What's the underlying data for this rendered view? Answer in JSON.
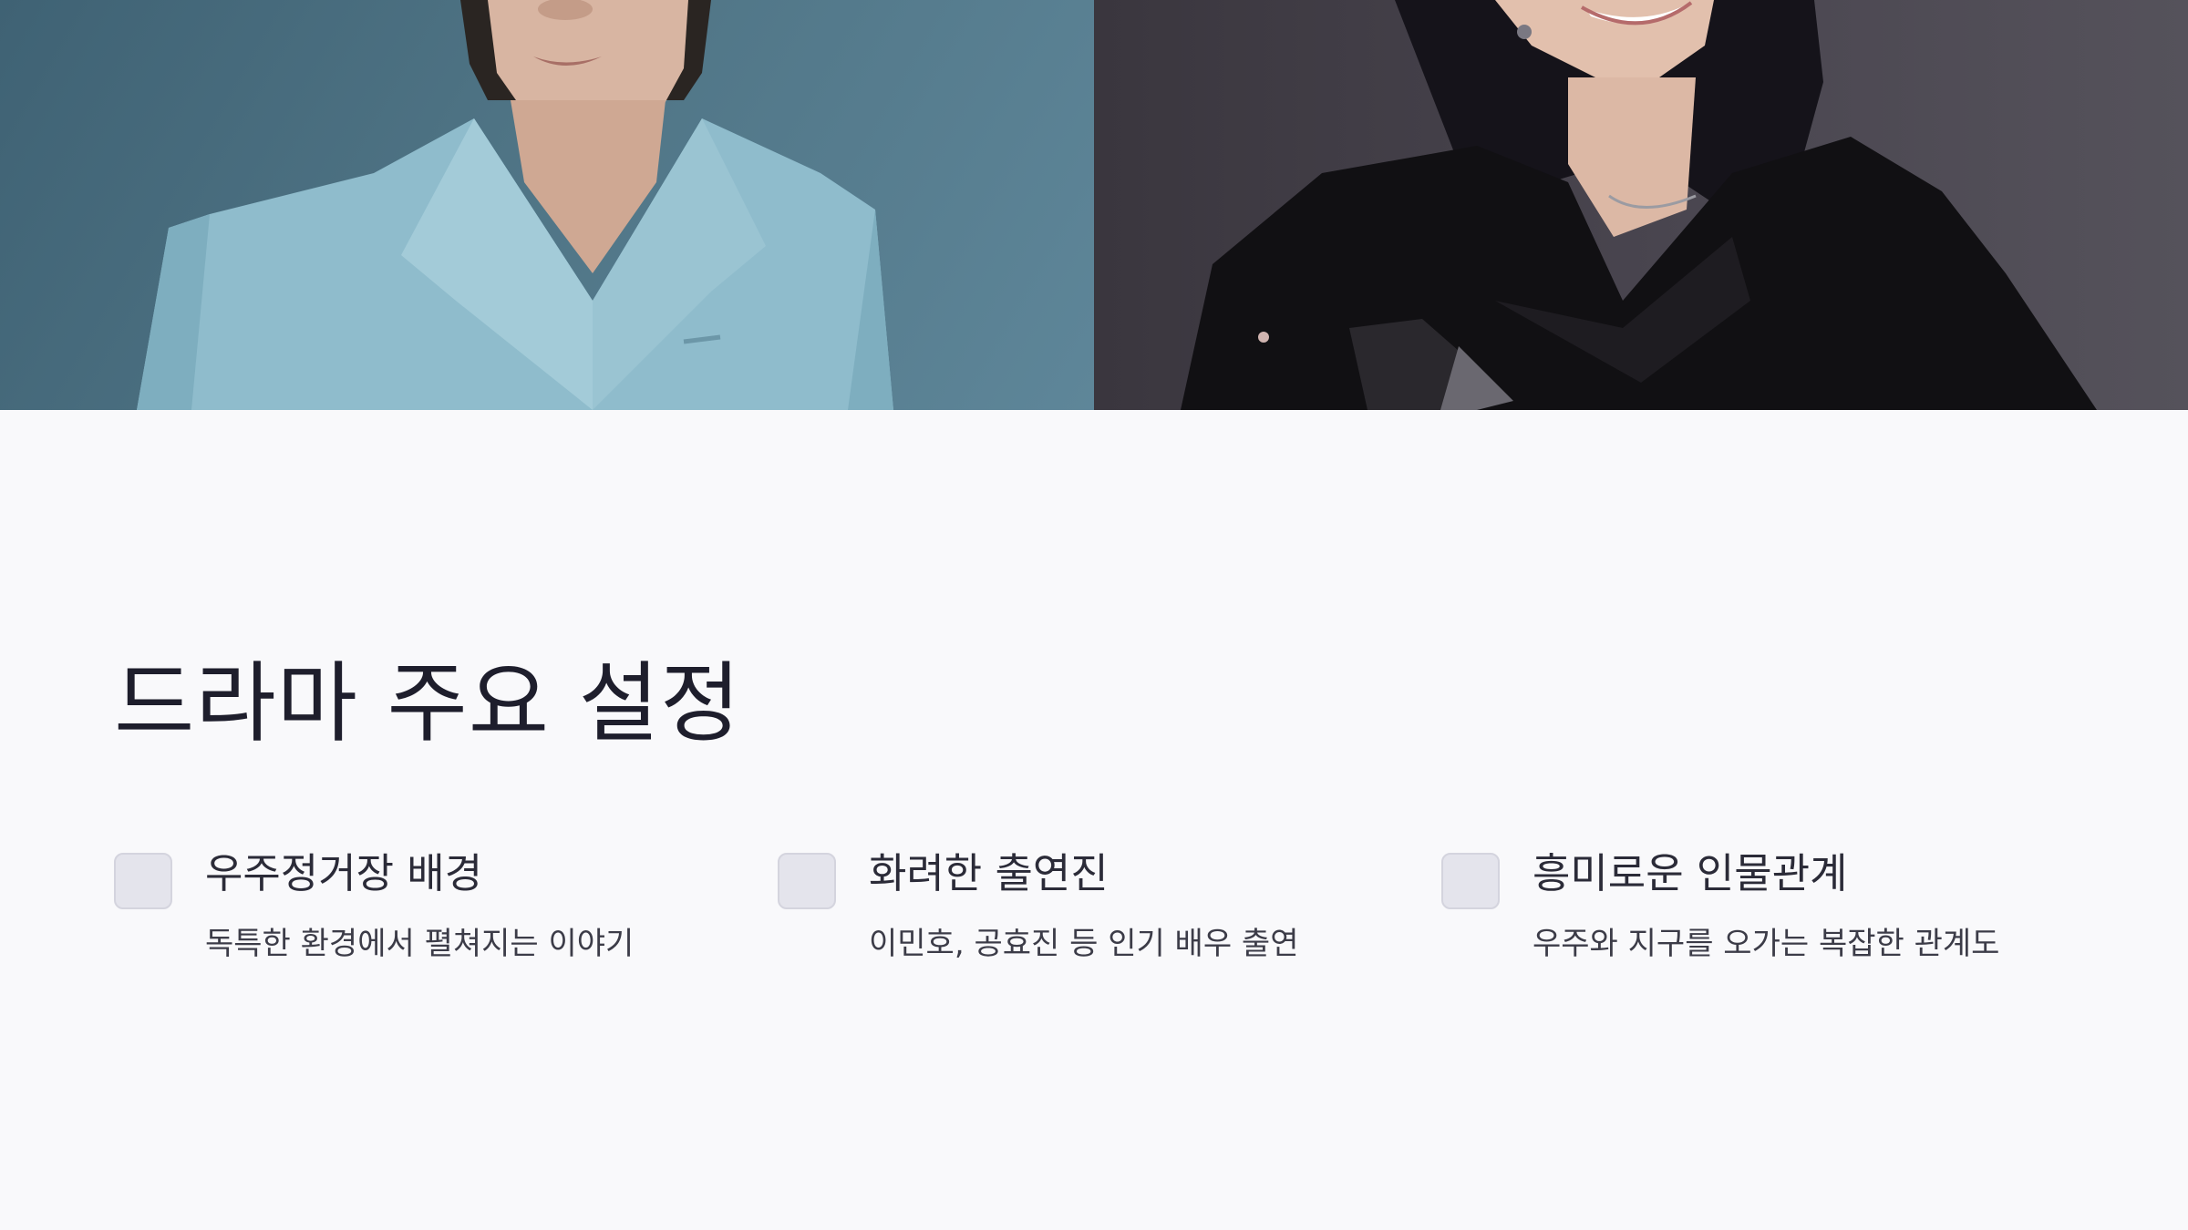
{
  "slide": {
    "title": "드라마 주요 설정",
    "photos": [
      {
        "subject": "man-in-light-blue-coat"
      },
      {
        "subject": "woman-in-black-jacket"
      }
    ],
    "features": [
      {
        "title": "우주정거장 배경",
        "description": "독특한 환경에서 펼쳐지는 이야기",
        "icon": "checkbox-icon"
      },
      {
        "title": "화려한 출연진",
        "description": "이민호, 공효진 등 인기 배우 출연",
        "icon": "checkbox-icon"
      },
      {
        "title": "흥미로운 인물관계",
        "description": "우주와 지구를 오가는 복잡한 관계도",
        "icon": "checkbox-icon"
      }
    ],
    "colors": {
      "background": "#f9f9fb",
      "title": "#1e1e2c",
      "checkbox_fill": "#e4e4ec",
      "photo_left_bg": "#4f7485",
      "photo_right_bg": "#4a4650"
    }
  }
}
